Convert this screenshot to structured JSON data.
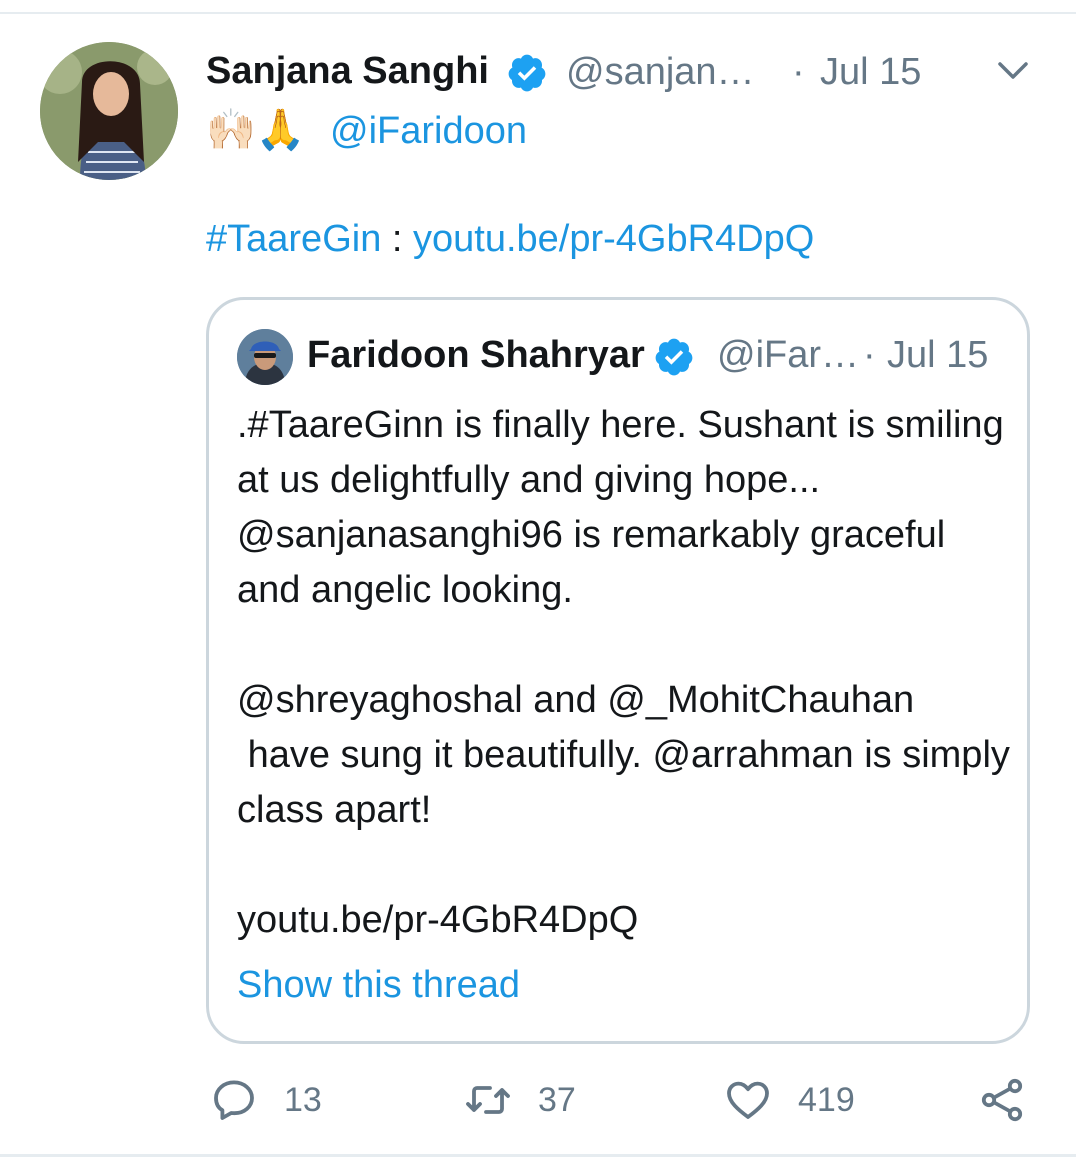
{
  "tweet": {
    "author_name": "Sanjana Sanghi",
    "handle": "@sanjan…",
    "separator": "·",
    "date": "Jul 15",
    "emojis": "🙌🏻🙏",
    "mention": "@iFaridoon",
    "hashtag": "#TaareGin",
    "colon": " : ",
    "link": "youtu.be/pr-4GbR4DpQ"
  },
  "quoted": {
    "author_name": "Faridoon Shahryar",
    "handle": "@iFar…",
    "separator": "·",
    "date": "Jul 15",
    "paragraphs": [
      ".#TaareGinn is finally here. Sushant is smiling at us delightfully and giving hope... @sanjanasanghi96 is remarkably graceful and angelic looking.",
      "@shreyaghoshal and @_MohitChauhan\n have sung it beautifully. @arrahman is simply class apart!",
      "youtu.be/pr-4GbR4DpQ"
    ],
    "show_thread": "Show this thread"
  },
  "actions": {
    "replies": "13",
    "retweets": "37",
    "likes": "419"
  },
  "colors": {
    "accent": "#1b95e0",
    "muted": "#657786",
    "border": "#ccd6dd",
    "text": "#14171a"
  },
  "icons": [
    "verified-badge-icon",
    "chevron-down-icon",
    "reply-icon",
    "retweet-icon",
    "heart-icon",
    "share-icon"
  ]
}
